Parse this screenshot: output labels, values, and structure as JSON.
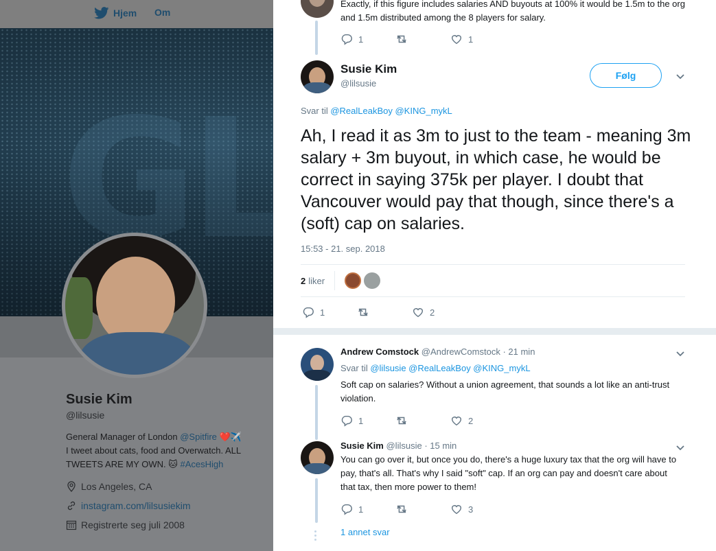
{
  "nav": {
    "home_label": "Hjem",
    "about_label": "Om"
  },
  "profile": {
    "name": "Susie Kim",
    "handle": "@lilsusie",
    "bio_part1": "General Manager of London ",
    "bio_link": "@Spitfire",
    "bio_emoji1": "❤️✈️",
    "bio_part2": "I tweet about cats, food and Overwatch. ALL TWEETS ARE MY OWN. ",
    "bio_emoji2": "🐱",
    "bio_hashtag": "#AcesHigh",
    "location": "Los Angeles, CA",
    "website": "instagram.com/lilsusiekim",
    "joined": "Registrerte seg juli 2008"
  },
  "thread": {
    "prev_tweet": {
      "text": "Exactly, if this figure includes salaries AND buyouts at 100% it would be 1.5m to the org and 1.5m distributed among the 8 players for salary.",
      "replies": "1",
      "retweets": "",
      "likes": "1"
    },
    "main_tweet": {
      "name": "Susie Kim",
      "handle": "@lilsusie",
      "follow_label": "Følg",
      "reply_prefix": "Svar til ",
      "reply_to": "@RealLeakBoy @KING_mykL",
      "text": "Ah, I read it as 3m to just to the team - meaning 3m salary + 3m buyout, in which case, he would be correct in saying 375k per player. I doubt that Vancouver would pay that though, since there's a (soft) cap on salaries.",
      "timestamp": "15:53 - 21. sep. 2018",
      "likes_count": "2",
      "likes_label": "liker",
      "replies": "1",
      "retweets": "",
      "likes": "2"
    },
    "replies": [
      {
        "name": "Andrew Comstock",
        "handle": "@AndrewComstock",
        "time": "· 21 min",
        "reply_prefix": "Svar til ",
        "reply_to": "@lilsusie @RealLeakBoy @KING_mykL",
        "text": "Soft cap on salaries? Without a union agreement, that sounds a lot like an anti-trust violation.",
        "replies": "1",
        "retweets": "",
        "likes": "2"
      },
      {
        "name": "Susie Kim",
        "handle": "@lilsusie",
        "time": "· 15 min",
        "text": "You can go over it, but once you do, there's a huge luxury tax that the org will have to pay, that's all. That's why I said \"soft\" cap. If an org can pay and doesn't care about that tax, then more power to them!",
        "replies": "1",
        "retweets": "",
        "likes": "3"
      }
    ],
    "show_more_label": "1 annet svar"
  },
  "colors": {
    "accent": "#1da1f2",
    "link": "#1b95e0",
    "muted": "#657786",
    "thread_line": "#c4d6e6",
    "like_heart": "#e0245e"
  }
}
